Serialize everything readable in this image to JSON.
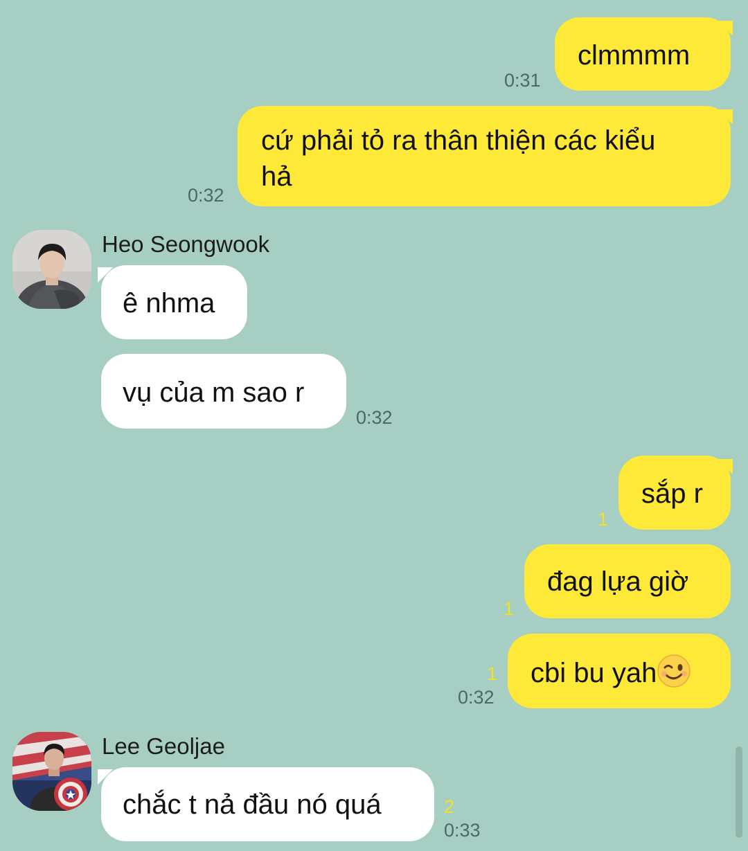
{
  "colors": {
    "background": "#a6cec2",
    "outgoing_bubble": "#fee938",
    "incoming_bubble": "#ffffff",
    "unread_count": "#f2e12a"
  },
  "messages": [
    {
      "text": "clmmmm",
      "time": "0:31"
    },
    {
      "text": "cứ phải tỏ ra thân thiện các kiểu",
      "text2": "hả",
      "time": "0:32"
    },
    {
      "sender": "Heo Seongwook",
      "text": "ê nhma"
    },
    {
      "text": "vụ của m sao r",
      "time": "0:32"
    },
    {
      "text": "sắp r",
      "unread": "1"
    },
    {
      "text": "đag lựa giờ",
      "unread": "1"
    },
    {
      "text": "cbi bu yah",
      "emoji": "wink-emoji",
      "unread": "1",
      "time": "0:32"
    },
    {
      "sender": "Lee Geoljae",
      "text": "chắc t nả đầu nó quá",
      "unread": "2",
      "time": "0:33"
    }
  ]
}
